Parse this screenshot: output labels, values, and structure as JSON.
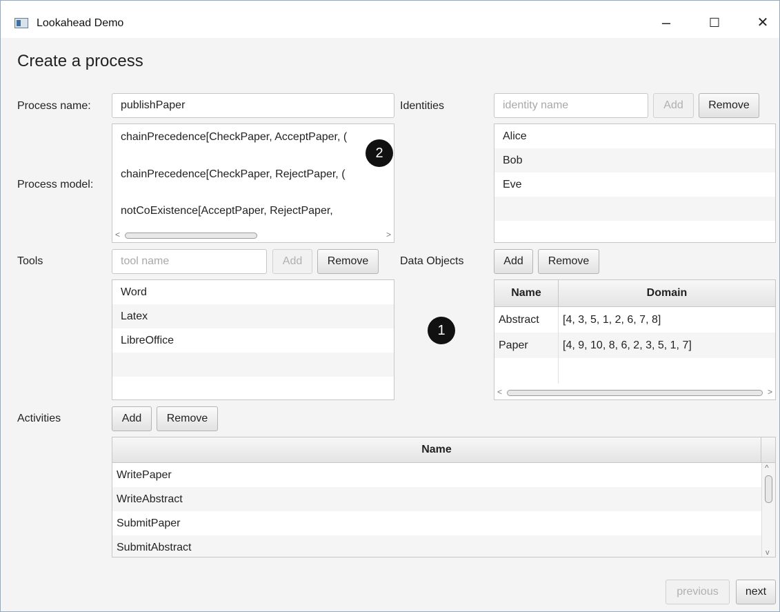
{
  "window": {
    "title": "Lookahead Demo",
    "minimize": "–",
    "maximize": "☐",
    "close": "✕"
  },
  "page": {
    "heading": "Create a process"
  },
  "process_name": {
    "label": "Process name:",
    "value": "publishPaper"
  },
  "process_model": {
    "label": "Process model:",
    "lines": [
      "chainPrecedence[CheckPaper, AcceptPaper, (",
      "chainPrecedence[CheckPaper, RejectPaper, (",
      "notCoExistence[AcceptPaper, RejectPaper,"
    ]
  },
  "identities": {
    "label": "Identities",
    "placeholder": "identity name",
    "add_label": "Add",
    "remove_label": "Remove",
    "items": [
      "Alice",
      "Bob",
      "Eve"
    ]
  },
  "tools": {
    "label": "Tools",
    "placeholder": "tool name",
    "add_label": "Add",
    "remove_label": "Remove",
    "items": [
      "Word",
      "Latex",
      "LibreOffice"
    ]
  },
  "data_objects": {
    "label": "Data Objects",
    "add_label": "Add",
    "remove_label": "Remove",
    "columns": [
      "Name",
      "Domain"
    ],
    "rows": [
      {
        "name": "Abstract",
        "domain": "[4, 3, 5, 1, 2, 6, 7, 8]"
      },
      {
        "name": "Paper",
        "domain": "[4, 9, 10, 8, 6, 2, 3, 5, 1, 7]"
      }
    ]
  },
  "activities": {
    "label": "Activities",
    "add_label": "Add",
    "remove_label": "Remove",
    "column": "Name",
    "rows": [
      "WritePaper",
      "WriteAbstract",
      "SubmitPaper",
      "SubmitAbstract"
    ]
  },
  "callouts": {
    "one": "1",
    "two": "2"
  },
  "nav": {
    "previous_label": "previous",
    "next_label": "next"
  }
}
